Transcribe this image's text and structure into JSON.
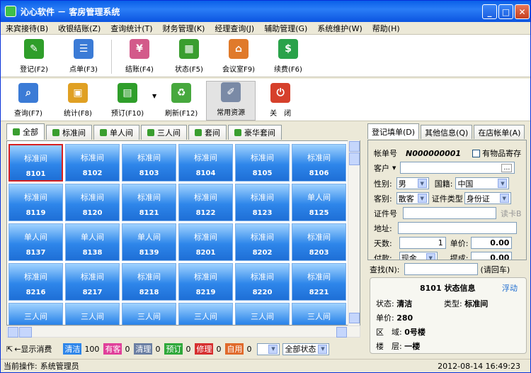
{
  "window": {
    "title": "沁心软件 － 客房管理系统"
  },
  "menu": [
    "来宾接待(B)",
    "收银结账(Z)",
    "查询统计(T)",
    "财务管理(K)",
    "经理查询(J)",
    "辅助管理(G)",
    "系统维护(W)",
    "帮助(H)"
  ],
  "toolbar1": [
    {
      "label": "登记(F2)",
      "icon": "register-icon",
      "color": "#2f9e2a"
    },
    {
      "label": "点单(F3)",
      "icon": "order-icon",
      "color": "#3b7bd6"
    },
    {
      "label": "结账(F4)",
      "icon": "checkout-icon",
      "color": "#d35a8a"
    },
    {
      "label": "状态(F5)",
      "icon": "status-icon",
      "color": "#3a9e2f"
    },
    {
      "label": "会议室F9)",
      "icon": "meeting-room-icon",
      "color": "#e07a2b"
    },
    {
      "label": "续费(F6)",
      "icon": "renew-icon",
      "color": "#2aa24a"
    }
  ],
  "toolbar2": [
    {
      "label": "查询(F7)",
      "icon": "search-icon",
      "color": "#3b7bd6"
    },
    {
      "label": "统计(F8)",
      "icon": "statistics-icon",
      "color": "#e0a023"
    },
    {
      "label": "预订(F10)",
      "icon": "reserve-icon",
      "color": "#2f9e2a"
    },
    {
      "label": "刷新(F12)",
      "icon": "refresh-icon",
      "color": "#46a83d"
    },
    {
      "label": "常用资源",
      "icon": "resources-icon",
      "color": "#7a8aa6"
    },
    {
      "label": "关　闭",
      "icon": "close-power-icon",
      "color": "#d6402b"
    }
  ],
  "room_tabs": [
    "全部",
    "标准间",
    "单人间",
    "三人间",
    "套间",
    "豪华套间"
  ],
  "rooms": [
    {
      "type": "标准间",
      "no": "8101"
    },
    {
      "type": "标准间",
      "no": "8102"
    },
    {
      "type": "标准间",
      "no": "8103"
    },
    {
      "type": "标准间",
      "no": "8104"
    },
    {
      "type": "标准间",
      "no": "8105"
    },
    {
      "type": "标准间",
      "no": "8106"
    },
    {
      "type": "标准间",
      "no": "8119"
    },
    {
      "type": "标准间",
      "no": "8120"
    },
    {
      "type": "标准间",
      "no": "8121"
    },
    {
      "type": "标准间",
      "no": "8122"
    },
    {
      "type": "标准间",
      "no": "8123"
    },
    {
      "type": "单人间",
      "no": "8125"
    },
    {
      "type": "单人间",
      "no": "8137"
    },
    {
      "type": "单人间",
      "no": "8138"
    },
    {
      "type": "单人间",
      "no": "8139"
    },
    {
      "type": "标准间",
      "no": "8201"
    },
    {
      "type": "标准间",
      "no": "8202"
    },
    {
      "type": "标准间",
      "no": "8203"
    },
    {
      "type": "标准间",
      "no": "8216"
    },
    {
      "type": "标准间",
      "no": "8217"
    },
    {
      "type": "标准间",
      "no": "8218"
    },
    {
      "type": "标准间",
      "no": "8219"
    },
    {
      "type": "标准间",
      "no": "8220"
    },
    {
      "type": "标准间",
      "no": "8221"
    },
    {
      "type": "三人间",
      "no": ""
    },
    {
      "type": "三人间",
      "no": ""
    },
    {
      "type": "三人间",
      "no": ""
    },
    {
      "type": "三人间",
      "no": ""
    },
    {
      "type": "三人间",
      "no": ""
    },
    {
      "type": "三人间",
      "no": ""
    }
  ],
  "legend": {
    "show_consume": "←显示消费",
    "items": [
      {
        "label": "清洁",
        "value": "100",
        "color": "#2e86ea"
      },
      {
        "label": "有客",
        "value": "0",
        "color": "#e0409a"
      },
      {
        "label": "清理",
        "value": "0",
        "color": "#6b7fa3"
      },
      {
        "label": "预订",
        "value": "0",
        "color": "#2fa83a"
      },
      {
        "label": "修理",
        "value": "0",
        "color": "#d63030"
      },
      {
        "label": "自用",
        "value": "0",
        "color": "#e06a2b"
      }
    ],
    "filter": "全部状态"
  },
  "right_tabs": [
    "登记填单(D)",
    "其他信息(Q)",
    "在店帐单(A)"
  ],
  "form": {
    "account_label": "帐单号",
    "account_value": "N000000001",
    "deposit_label": "有物品寄存",
    "customer_label": "客户",
    "gender_label": "性别:",
    "gender": "男",
    "nation_label": "国籍:",
    "nation": "中国",
    "guest_type_label": "客别:",
    "guest_type": "散客",
    "id_type_label": "证件类型",
    "id_type": "身份证",
    "id_no_label": "证件号",
    "read_card": "读卡B",
    "address_label": "地址:",
    "days_label": "天数:",
    "days": "1",
    "price_label": "单价:",
    "price": "0.00",
    "pay_label": "付款:",
    "pay": "现金",
    "commission_label": "提成:",
    "commission": "0.00"
  },
  "search": {
    "label": "查找(N):",
    "hint": "(请回车)"
  },
  "info": {
    "title": "8101 状态信息",
    "float": "浮动",
    "status_label": "状态:",
    "status": "清洁",
    "type_label": "类型:",
    "type": "标准间",
    "price_label": "单价:",
    "price": "280",
    "area_label": "区　域:",
    "area": "0号楼",
    "floor_label": "楼　层:",
    "floor": "一楼"
  },
  "statusbar": {
    "current_label": "当前操作:",
    "current": "系统管理员",
    "datetime": "2012-08-14  16:49:23"
  }
}
